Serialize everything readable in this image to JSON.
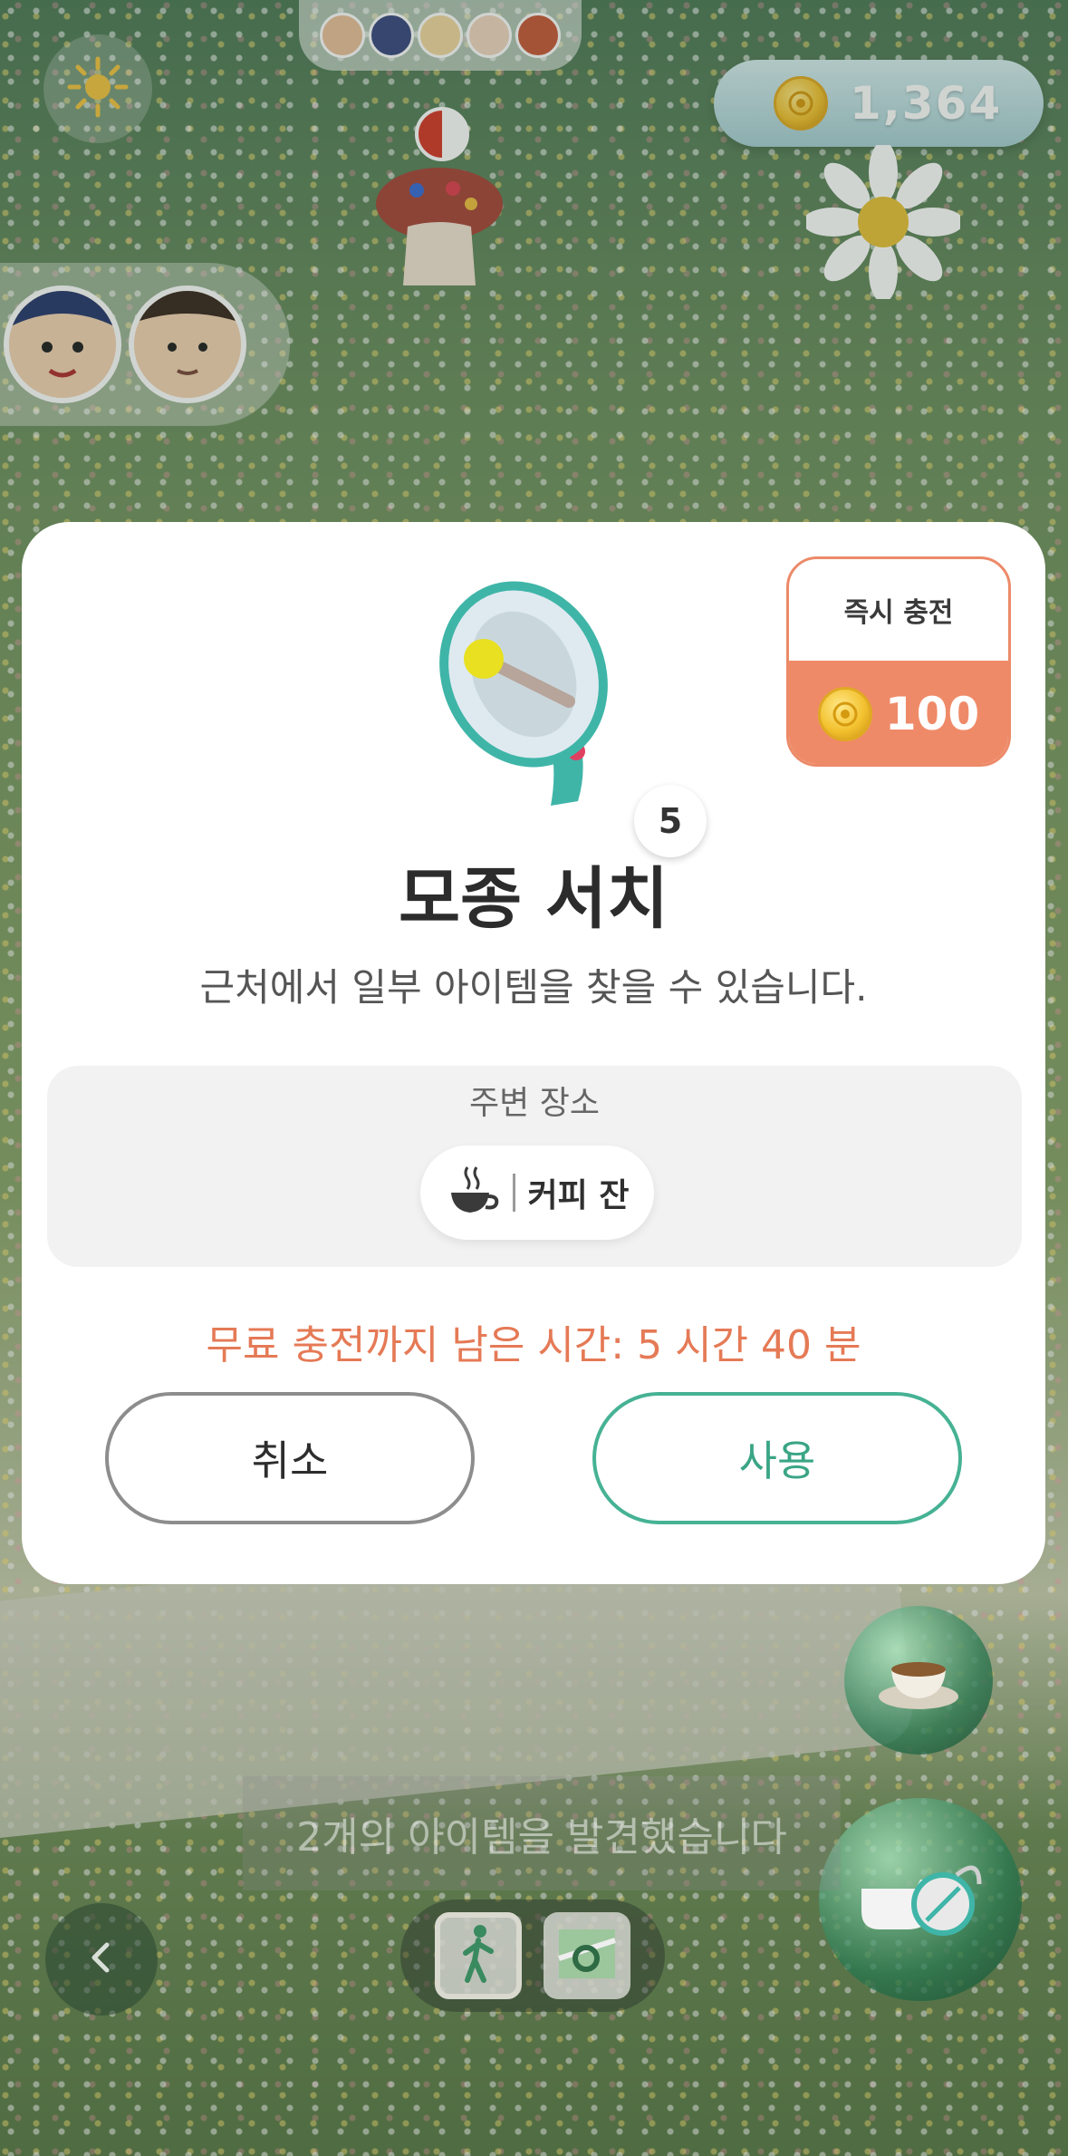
{
  "hud": {
    "coin_balance": "1,364",
    "sun_icon": "sun-icon",
    "coin_icon": "coin-icon"
  },
  "modal": {
    "instant_charge_label": "즉시 충전",
    "instant_charge_price": "100",
    "item_icon": "megaphone-icon",
    "item_count": "5",
    "title": "모종 서치",
    "description": "근처에서 일부 아이템을 찾을 수 있습니다.",
    "nearby": {
      "label": "주변 장소",
      "place_icon": "coffee-cup-icon",
      "place_name": "커피 잔"
    },
    "timer_text": "무료 충전까지 남은 시간: 5 시간 40 분",
    "cancel_label": "취소",
    "use_label": "사용"
  },
  "bottom": {
    "toast_text": "2개의 아이템을 발견했습니다",
    "back_icon": "chevron-left-icon",
    "mode_walk_icon": "walking-person-icon",
    "mode_map_icon": "map-icon",
    "cup_orb_icon": "coffee-cup-icon",
    "whistle_icon": "whistle-icon"
  },
  "colors": {
    "accent_orange": "#ef8a68",
    "accent_green": "#46b294",
    "timer_text": "#e57a56"
  }
}
